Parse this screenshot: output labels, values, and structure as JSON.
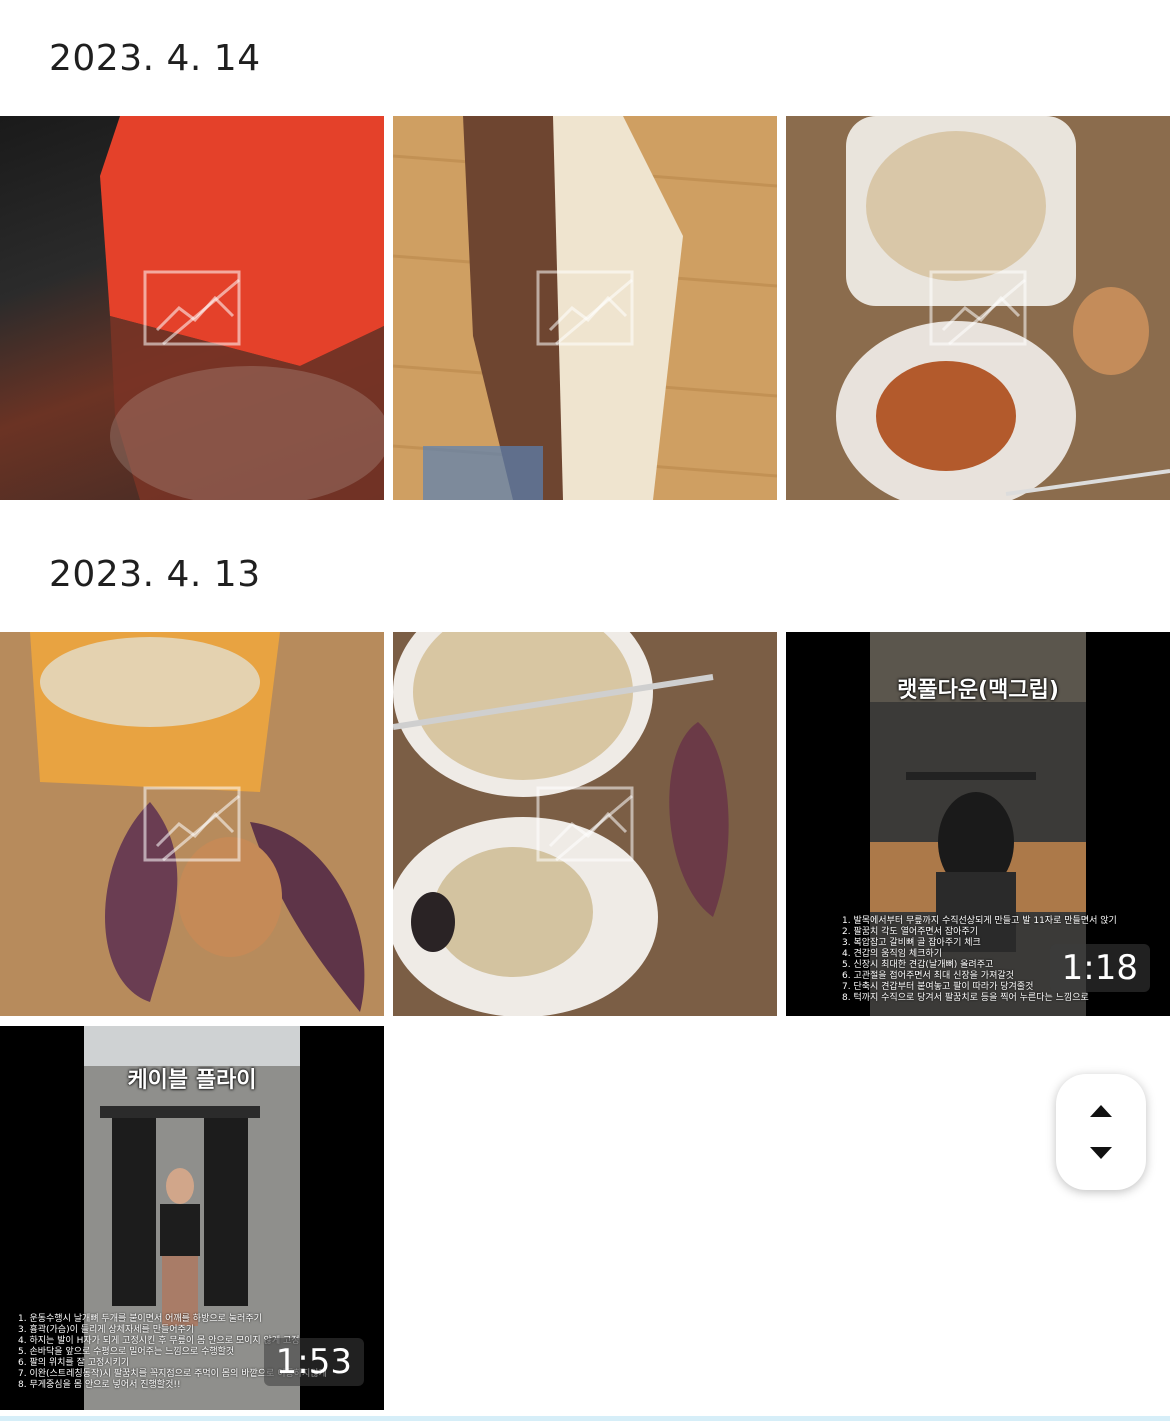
{
  "sections": [
    {
      "date": "2023. 4. 14"
    },
    {
      "date": "2023. 4. 13"
    }
  ],
  "items": [
    {
      "kind": "photo",
      "subject": "orange snack packet"
    },
    {
      "kind": "photo",
      "subject": "Cornetto al Cioccolato packet"
    },
    {
      "kind": "photo",
      "subject": "rice, chicken and egg"
    },
    {
      "kind": "photo",
      "subject": "chicken snack, sweet potatoes and egg"
    },
    {
      "kind": "photo",
      "subject": "rice, porridge and sweet potato"
    },
    {
      "kind": "video",
      "title": "랫풀다운(맥그립)",
      "duration": "1:18",
      "notes": [
        "1. 발목에서부터 무릎까지 수직선상되게 만들고 발 11자로 만들면서 앉기",
        "2. 팔꿈치 각도 열어주면서 잡아주기",
        "3. 복압잡고 갈비뼈 골 잡아주기 체크",
        "4. 견갑의 움직임 체크하기",
        "5. 신장시 최대한 견갑(날개뼈) 올려주고",
        "6. 고관절을 접어주면서 최대 신장을 가져갈것",
        "7. 단축시 견갑부터 붙여놓고 팔이 따라가 당겨줄것",
        "8. 턱까지 수직으로 당겨서 팔꿈치로 등을 찍어 누른다는 느낌으로"
      ]
    },
    {
      "kind": "video",
      "title": "케이블 플라이",
      "duration": "1:53",
      "notes": [
        "1. 운동수행시 날개뼈 두개를 붙이면서 어깨를 하방으로 눌러주기",
        "3. 흉곽(가슴)이 들리게 상체자세를 만들어주기",
        "4. 하지는 발이 H자가 되게 고정시킨 후 무릎이 몸 안으로 모이지 않게 고정",
        "5. 손바닥을 앞으로 수평으로 밀어주는 느낌으로 수행할것",
        "6. 팔의 위치를 잘 고정시키기",
        "7. 이완(스트레칭동작)시 팔꿈치를 꼭지점으로 주먹이 몸의 바깥으로 이동하지않게",
        "8. 무게중심을 몸 안으로 넣어서 진행할것!!"
      ]
    }
  ],
  "colors": {
    "background": "#ffffff",
    "date_text": "#1f1f1f",
    "badge_bg": "#3c3c3c"
  },
  "scroll_control": {
    "up_icon": "triangle-up-icon",
    "down_icon": "triangle-down-icon"
  }
}
